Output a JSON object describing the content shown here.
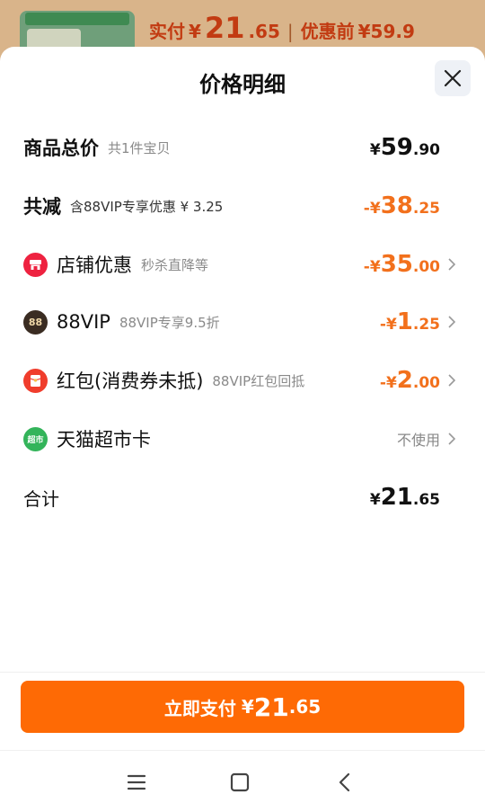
{
  "background": {
    "thumb_tag": "天猫超市",
    "paid_label": "实付",
    "paid_currency": "¥",
    "paid_int": "21",
    "paid_dec": ".65",
    "before_label": "优惠前",
    "before_value": "¥59.9"
  },
  "sheet": {
    "title": "价格明细",
    "rows": [
      {
        "label": "商品总价",
        "sub": "共1件宝贝",
        "currency": "¥",
        "int": "59",
        "dec": ".90",
        "sign": ""
      },
      {
        "label": "共减",
        "sub": "含88VIP专享优惠 ¥ 3.25",
        "currency": "¥",
        "int": "38",
        "dec": ".25",
        "sign": "-"
      },
      {
        "label": "店铺优惠",
        "sub": "秒杀直降等",
        "currency": "¥",
        "int": "35",
        "dec": ".00",
        "sign": "-"
      },
      {
        "label": "88VIP",
        "sub": "88VIP专享9.5折",
        "currency": "¥",
        "int": "1",
        "dec": ".25",
        "sign": "-"
      },
      {
        "label": "红包(消费券未抵)",
        "sub": "88VIP红包回抵",
        "currency": "¥",
        "int": "2",
        "dec": ".00",
        "sign": "-"
      },
      {
        "label": "天猫超市卡",
        "status": "不使用"
      },
      {
        "label": "合计",
        "currency": "¥",
        "int": "21",
        "dec": ".65"
      }
    ]
  },
  "icons": {
    "shop": "shop-icon",
    "vip": "88vip-icon",
    "redpacket": "red-packet-icon",
    "supermarket": "supermarket-card-icon",
    "supermarket_text": "超市",
    "vip_text": "88"
  },
  "pay_button": {
    "label": "立即支付",
    "currency": "¥",
    "int": "21",
    "dec": ".65"
  },
  "colors": {
    "accent": "#fe6a05",
    "discount": "#f2701c"
  }
}
